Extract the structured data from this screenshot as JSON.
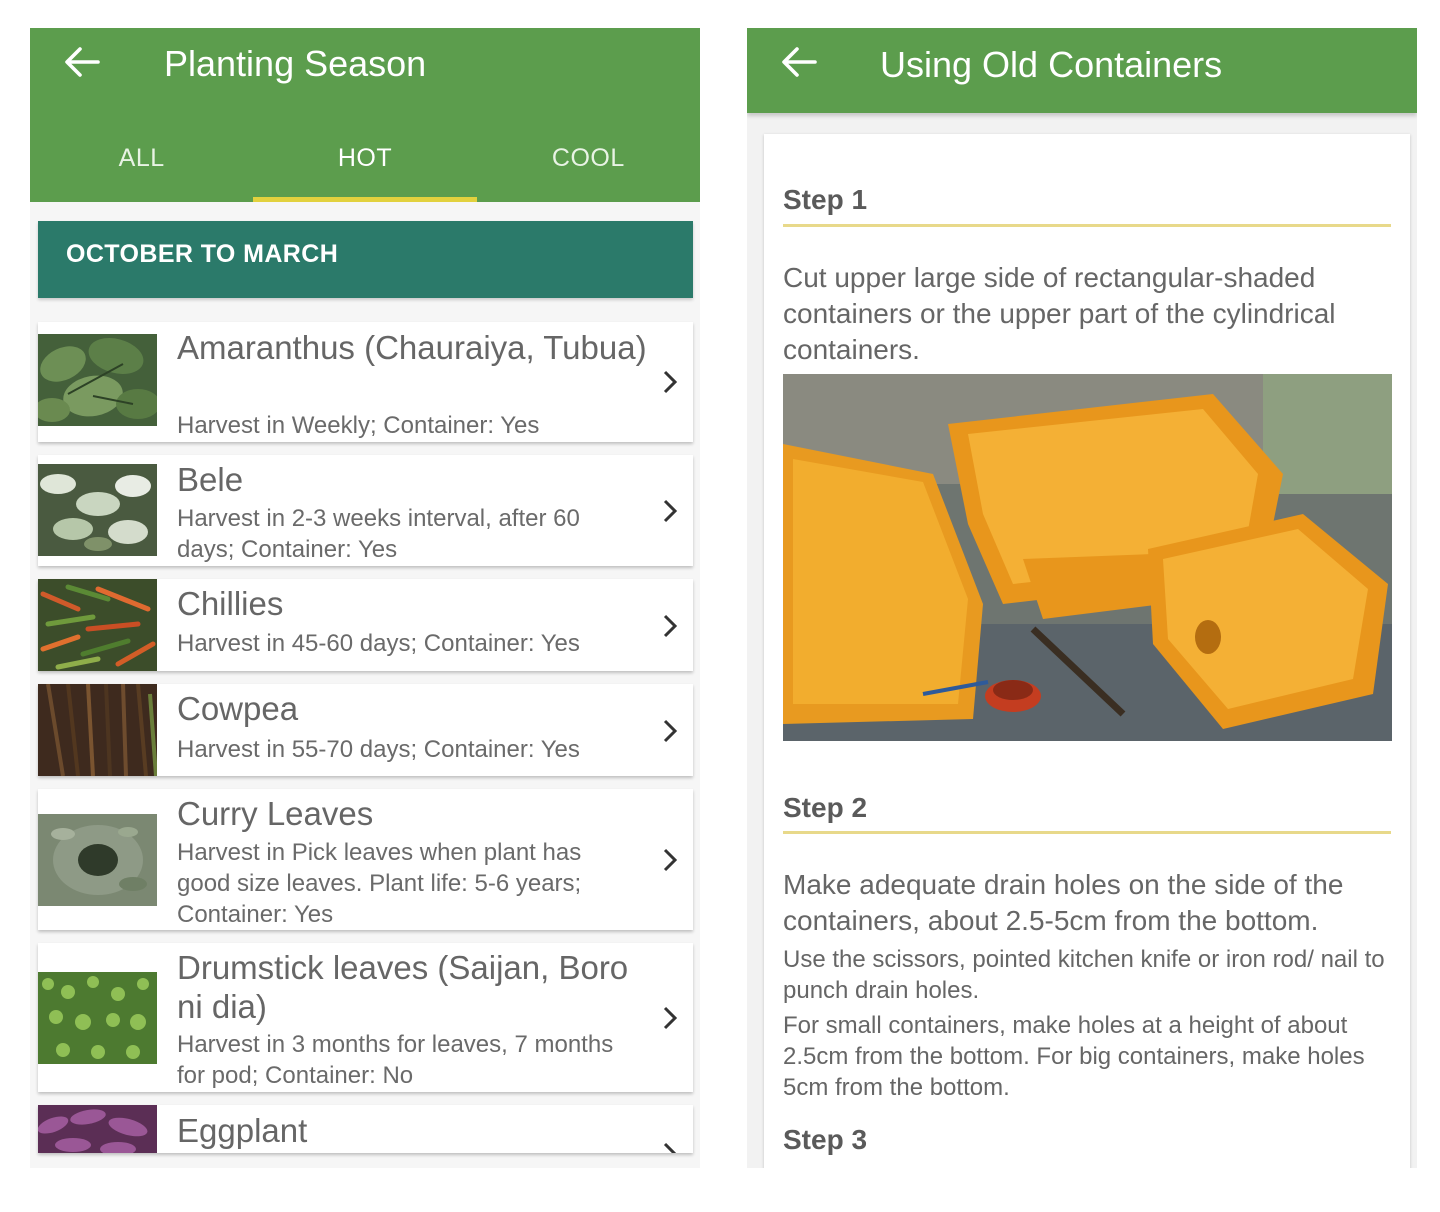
{
  "left_screen": {
    "title": "Planting Season",
    "tabs": [
      {
        "label": "ALL",
        "active": false
      },
      {
        "label": "HOT",
        "active": true
      },
      {
        "label": "COOL",
        "active": false
      }
    ],
    "section_header": "OCTOBER TO MARCH",
    "items": [
      {
        "title": "Amaranthus (Chauraiya, Tubua)",
        "subtitle": "Harvest in Weekly; Container: Yes",
        "image": "amaranthus-leaves"
      },
      {
        "title": "Bele",
        "subtitle": "Harvest in 2-3 weeks interval, after 60 days; Container: Yes",
        "image": "bele-plant"
      },
      {
        "title": "Chillies",
        "subtitle": "Harvest in 45-60 days; Container: Yes",
        "image": "chillies"
      },
      {
        "title": "Cowpea",
        "subtitle": "Harvest in 55-70 days; Container: Yes",
        "image": "cowpea"
      },
      {
        "title": "Curry Leaves",
        "subtitle": "Harvest in Pick leaves when plant has good size leaves. Plant life: 5-6 years; Container: Yes",
        "image": "curry-leaves"
      },
      {
        "title": "Drumstick leaves (Saijan, Boro ni dia)",
        "subtitle": "Harvest in 3 months for leaves, 7 months for pod; Container: No",
        "image": "drumstick-leaves"
      },
      {
        "title": "Eggplant",
        "subtitle": "",
        "image": "eggplant"
      }
    ]
  },
  "right_screen": {
    "title": "Using Old Containers",
    "steps": [
      {
        "heading": "Step 1",
        "paragraphs": [
          "Cut upper large side of rectangular-shaded containers or the upper part of the cylindrical containers."
        ],
        "image": "orange-plastic-containers-cut"
      },
      {
        "heading": "Step 2",
        "lead": "Make adequate drain holes on the side of the containers, about 2.5-5cm from the bottom.",
        "paragraphs": [
          "Use the scissors, pointed kitchen knife or iron rod/ nail to punch drain holes.",
          "For small containers, make holes at a height of about 2.5cm from the bottom. For big containers, make holes 5cm from the bottom."
        ]
      },
      {
        "heading": "Step 3"
      }
    ]
  },
  "colors": {
    "appbar": "#5c9d4d",
    "section_header": "#2b7a6a",
    "tab_indicator": "#e2d13e",
    "step_rule": "#e8d98a"
  },
  "icons": [
    "back-arrow-icon",
    "chevron-right-icon"
  ]
}
